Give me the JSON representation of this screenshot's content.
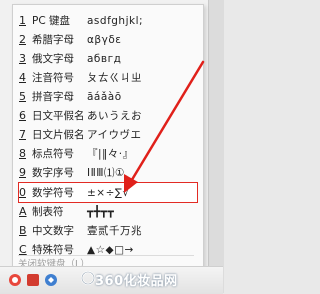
{
  "menu": {
    "items": [
      {
        "key": "1",
        "label": "PC 键盘",
        "sample": "asdfghjkl;"
      },
      {
        "key": "2",
        "label": "希腊字母",
        "sample": "αβγδε"
      },
      {
        "key": "3",
        "label": "俄文字母",
        "sample": "абвгд"
      },
      {
        "key": "4",
        "label": "注音符号",
        "sample": "ㄆㄊㄍㄐㄓ"
      },
      {
        "key": "5",
        "label": "拼音字母",
        "sample": "āáǎàō"
      },
      {
        "key": "6",
        "label": "日文平假名",
        "sample": "あいうえお"
      },
      {
        "key": "7",
        "label": "日文片假名",
        "sample": "アイウヴエ"
      },
      {
        "key": "8",
        "label": "标点符号",
        "sample": "『|‖々·』"
      },
      {
        "key": "9",
        "label": "数字序号",
        "sample": "ⅠⅡⅢ⑴①"
      },
      {
        "key": "0",
        "label": "数学符号",
        "sample": "±×÷∑√"
      },
      {
        "key": "A",
        "label": "制表符",
        "sample": "┳╋┳┳"
      },
      {
        "key": "B",
        "label": "中文数字",
        "sample": "壹贰千万兆"
      },
      {
        "key": "C",
        "label": "特殊符号",
        "sample": "▲☆◆□→"
      }
    ],
    "selected_index": 9,
    "close_label": "关闭软键盘（L）"
  },
  "watermark": {
    "text": "360化妆品网"
  },
  "colors": {
    "highlight_border": "#e22b24",
    "arrow": "#e0201a"
  }
}
